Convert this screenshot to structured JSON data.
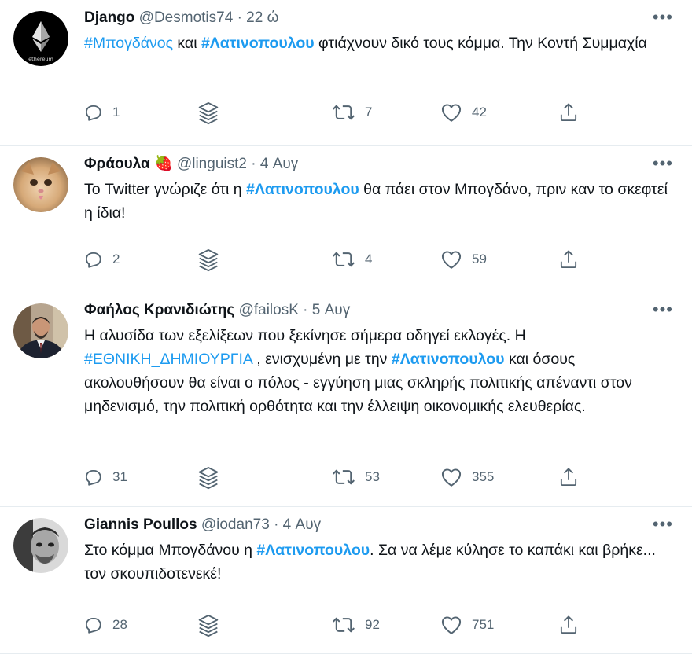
{
  "tweets": [
    {
      "name": "Django",
      "emoji": "",
      "handle": "@Desmotis74",
      "sep": "·",
      "time": "22 ώ",
      "avatar": {
        "bg": "#000000",
        "label": "ethereum"
      },
      "body": [
        {
          "text": "#Μπογδάνος",
          "style": "tag"
        },
        {
          "text": " και ",
          "style": "plain"
        },
        {
          "text": "#Λατινοπουλου",
          "style": "tagbold"
        },
        {
          "text": "  φτιάχνουν δικό τους κόμμα. Την Κοντή Συμμαχία",
          "style": "plain"
        }
      ],
      "replies": "1",
      "retweets": "7",
      "likes": "42"
    },
    {
      "name": "Φράουλα",
      "emoji": "🍓",
      "handle": "@linguist2",
      "sep": "·",
      "time": "4 Αυγ",
      "avatar": {
        "bg": "#c99a6b"
      },
      "body": [
        {
          "text": "Το Twitter γνώριζε ότι η ",
          "style": "plain"
        },
        {
          "text": "#Λατινοπουλου",
          "style": "tagbold"
        },
        {
          "text": " θα πάει στον Μπογδάνο, πριν καν το σκεφτεί η ίδια!",
          "style": "plain"
        }
      ],
      "replies": "2",
      "retweets": "4",
      "likes": "59"
    },
    {
      "name": "Φαήλος Κρανιδιώτης",
      "emoji": "",
      "handle": "@failosK",
      "sep": "·",
      "time": "5 Αυγ",
      "avatar": {
        "bg": "#7a6a5a"
      },
      "body": [
        {
          "text": "Η αλυσίδα των εξελίξεων που ξεκίνησε σήμερα οδηγεί εκλογές. Η ",
          "style": "plain"
        },
        {
          "text": "#ΕΘΝΙΚΗ_ΔΗΜΙΟΥΡΓΙΑ",
          "style": "tag"
        },
        {
          "text": " , ενισχυμένη με την ",
          "style": "plain"
        },
        {
          "text": "#Λατινοπουλου",
          "style": "tagbold"
        },
        {
          "text": " και όσους ακολουθήσουν θα είναι ο πόλος - εγγύηση μιας σκληρής πολιτικής απέναντι στον μηδενισμό, την πολιτική ορθότητα και την έλλειψη οικονομικής ελευθερίας.",
          "style": "plain"
        }
      ],
      "replies": "31",
      "retweets": "53",
      "likes": "355"
    },
    {
      "name": "Giannis Poullos",
      "emoji": "",
      "handle": "@iodan73",
      "sep": "·",
      "time": "4 Αυγ",
      "avatar": {
        "bg": "#8a8a8a"
      },
      "body": [
        {
          "text": "Στο κόμμα Μπογδάνου η ",
          "style": "plain"
        },
        {
          "text": "#Λατινοπουλου",
          "style": "tagbold"
        },
        {
          "text": ". Σα να λέμε κύλησε το καπάκι και βρήκε... τον σκουπιδοτενεκέ!",
          "style": "plain"
        }
      ],
      "replies": "28",
      "retweets": "92",
      "likes": "751"
    }
  ],
  "colors": {
    "accent": "#1d9bf0",
    "muted": "#536471",
    "divider": "#e6ecf0"
  },
  "icons": [
    "more-icon",
    "reply-icon",
    "stack-icon",
    "retweet-icon",
    "like-icon",
    "share-icon"
  ]
}
